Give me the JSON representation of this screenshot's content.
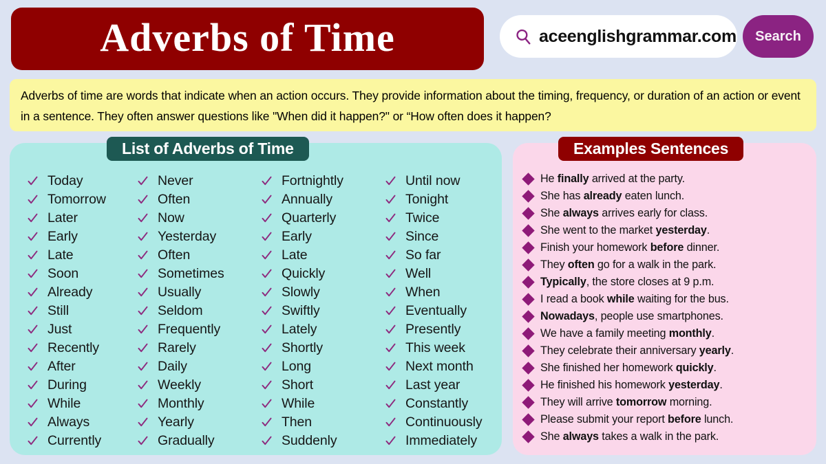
{
  "header": {
    "title": "Adverbs of Time",
    "search": {
      "icon": "search-icon",
      "value": "aceenglishgrammar.com",
      "button_label": "Search"
    }
  },
  "intro": {
    "text": "Adverbs of time are words that indicate when an action occurs. They provide information about the timing, frequency, or duration of an action or event in a sentence. They often answer questions like \"When did it happen?\" or “How often does it happen?"
  },
  "list_panel": {
    "header": "List of Adverbs of Time",
    "bullet_icon": "check-icon",
    "columns": [
      [
        "Today",
        "Tomorrow",
        "Later",
        "Early",
        "Late",
        "Soon",
        "Already",
        "Still",
        "Just",
        "Recently",
        "After",
        "During",
        "While",
        "Always",
        "Currently"
      ],
      [
        "Never",
        "Often",
        "Now",
        "Yesterday",
        "Often",
        "Sometimes",
        "Usually",
        "Seldom",
        "Frequently",
        "Rarely",
        "Daily",
        "Weekly",
        "Monthly",
        "Yearly",
        "Gradually"
      ],
      [
        "Fortnightly",
        "Annually",
        "Quarterly",
        "Early",
        "Late",
        "Quickly",
        "Slowly",
        "Swiftly",
        "Lately",
        "Shortly",
        "Long",
        "Short",
        "While",
        "Then",
        "Suddenly"
      ],
      [
        "Until now",
        "Tonight",
        "Twice",
        "Since",
        "So far",
        "Well",
        "When",
        "Eventually",
        "Presently",
        "This week",
        "Next month",
        "Last year",
        "Constantly",
        "Continuously",
        "Immediately"
      ]
    ]
  },
  "examples_panel": {
    "header": "Examples Sentences",
    "bullet_icon": "diamond-icon",
    "sentences": [
      {
        "parts": [
          {
            "t": "He ",
            "b": false
          },
          {
            "t": "finally",
            "b": true
          },
          {
            "t": " arrived at the party.",
            "b": false
          }
        ]
      },
      {
        "parts": [
          {
            "t": "She has ",
            "b": false
          },
          {
            "t": "already",
            "b": true
          },
          {
            "t": " eaten lunch.",
            "b": false
          }
        ]
      },
      {
        "parts": [
          {
            "t": "She ",
            "b": false
          },
          {
            "t": "always",
            "b": true
          },
          {
            "t": " arrives early for class.",
            "b": false
          }
        ]
      },
      {
        "parts": [
          {
            "t": "She went to the market ",
            "b": false
          },
          {
            "t": "yesterday",
            "b": true
          },
          {
            "t": ".",
            "b": false
          }
        ]
      },
      {
        "parts": [
          {
            "t": "Finish your homework ",
            "b": false
          },
          {
            "t": "before",
            "b": true
          },
          {
            "t": " dinner.",
            "b": false
          }
        ]
      },
      {
        "parts": [
          {
            "t": "They ",
            "b": false
          },
          {
            "t": "often",
            "b": true
          },
          {
            "t": " go for a walk in the park.",
            "b": false
          }
        ]
      },
      {
        "parts": [
          {
            "t": "Typically",
            "b": true
          },
          {
            "t": ", the store closes at 9 p.m.",
            "b": false
          }
        ]
      },
      {
        "parts": [
          {
            "t": "I read a book ",
            "b": false
          },
          {
            "t": "while",
            "b": true
          },
          {
            "t": " waiting for the bus.",
            "b": false
          }
        ]
      },
      {
        "parts": [
          {
            "t": "Nowadays",
            "b": true
          },
          {
            "t": ", people use smartphones.",
            "b": false
          }
        ]
      },
      {
        "parts": [
          {
            "t": "We have a family meeting ",
            "b": false
          },
          {
            "t": "monthly",
            "b": true
          },
          {
            "t": ".",
            "b": false
          }
        ]
      },
      {
        "parts": [
          {
            "t": "They celebrate their anniversary ",
            "b": false
          },
          {
            "t": "yearly",
            "b": true
          },
          {
            "t": ".",
            "b": false
          }
        ]
      },
      {
        "parts": [
          {
            "t": "She finished her homework ",
            "b": false
          },
          {
            "t": "quickly",
            "b": true
          },
          {
            "t": ".",
            "b": false
          }
        ]
      },
      {
        "parts": [
          {
            "t": "He finished his homework ",
            "b": false
          },
          {
            "t": "yesterday",
            "b": true
          },
          {
            "t": ".",
            "b": false
          }
        ]
      },
      {
        "parts": [
          {
            "t": "They will arrive ",
            "b": false
          },
          {
            "t": "tomorrow",
            "b": true
          },
          {
            "t": " morning.",
            "b": false
          }
        ]
      },
      {
        "parts": [
          {
            "t": "Please submit your report ",
            "b": false
          },
          {
            "t": "before",
            "b": true
          },
          {
            "t": " lunch.",
            "b": false
          }
        ]
      },
      {
        "parts": [
          {
            "t": "She ",
            "b": false
          },
          {
            "t": "always",
            "b": true
          },
          {
            "t": " takes a walk in the park.",
            "b": false
          }
        ]
      }
    ]
  },
  "colors": {
    "background": "#dce3f2",
    "banner_red": "#8f0000",
    "teal_panel": "#aeeae6",
    "teal_header": "#1d5953",
    "pink_panel": "#fbd7ea",
    "yellow_box": "#fbf7a0",
    "purple_accent": "#8b2382",
    "check_purple": "#8e2a7e",
    "diamond_purple": "#8e1a78"
  }
}
